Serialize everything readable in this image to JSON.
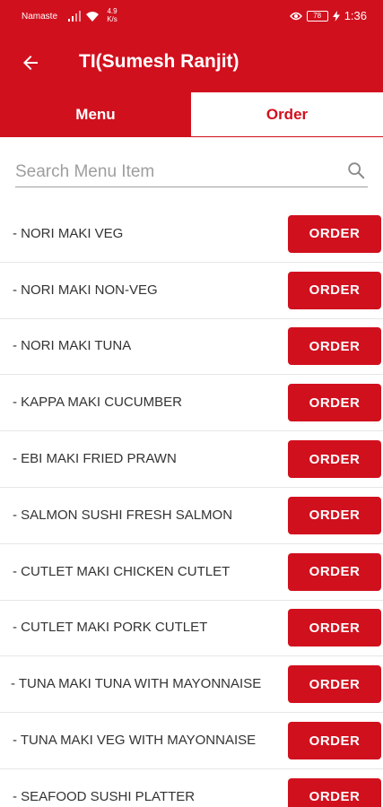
{
  "status_bar": {
    "carrier": "Namaste",
    "net_speed": "4.9",
    "net_speed_unit": "K/s",
    "battery": "78",
    "time": "1:36",
    "icons": [
      "signal-icon",
      "wifi-icon",
      "eye-icon",
      "battery-icon",
      "charging-icon"
    ]
  },
  "header": {
    "title": "TI(Sumesh Ranjit)",
    "back_icon": "arrow-left-icon",
    "color": "#d1101e"
  },
  "tabs": [
    {
      "label": "Menu",
      "selected": true
    },
    {
      "label": "Order",
      "selected": false
    }
  ],
  "search": {
    "placeholder": "Search Menu Item",
    "value": "",
    "icon": "search-icon"
  },
  "items": [
    {
      "name": "- NORI MAKI VEG",
      "action": "ORDER"
    },
    {
      "name": "- NORI MAKI NON-VEG",
      "action": "ORDER"
    },
    {
      "name": "- NORI MAKI TUNA",
      "action": "ORDER"
    },
    {
      "name": "- KAPPA MAKI CUCUMBER",
      "action": "ORDER"
    },
    {
      "name": "- EBI MAKI FRIED PRAWN",
      "action": "ORDER"
    },
    {
      "name": "- SALMON SUSHI FRESH SALMON",
      "action": "ORDER"
    },
    {
      "name": "- CUTLET MAKI CHICKEN CUTLET",
      "action": "ORDER"
    },
    {
      "name": "- CUTLET MAKI PORK CUTLET",
      "action": "ORDER"
    },
    {
      "name": "- TUNA MAKI TUNA WITH MAYONNAISE",
      "action": "ORDER"
    },
    {
      "name": "- TUNA MAKI VEG WITH MAYONNAISE",
      "action": "ORDER"
    },
    {
      "name": "- SEAFOOD SUSHI PLATTER",
      "action": "ORDER"
    }
  ]
}
